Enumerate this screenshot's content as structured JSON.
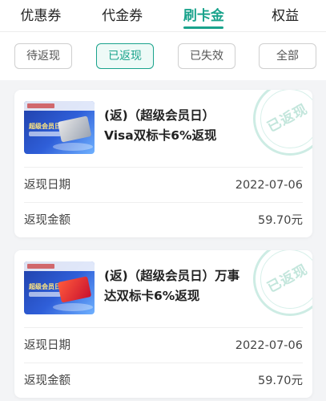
{
  "tabs": [
    {
      "label": "优惠券"
    },
    {
      "label": "代金券"
    },
    {
      "label": "刷卡金"
    },
    {
      "label": "权益"
    }
  ],
  "filters": [
    {
      "label": "待返现"
    },
    {
      "label": "已返现"
    },
    {
      "label": "已失效"
    },
    {
      "label": "全部"
    }
  ],
  "colors": {
    "accent": "#1aa38c",
    "stamp": "#c3e6dc"
  },
  "cards": [
    {
      "title_line1": "(返)（超级会员日）",
      "title_line2": "Visa双标卡6%返现",
      "thumb_text": "超级会员日",
      "stamp_text": "已返现",
      "date_label": "返现日期",
      "date_value": "2022-07-06",
      "amount_label": "返现金额",
      "amount_value": "59.70元"
    },
    {
      "title_line1": "(返)（超级会员日）万事",
      "title_line2": "达双标卡6%返现",
      "thumb_text": "超级会员日",
      "stamp_text": "已返现",
      "date_label": "返现日期",
      "date_value": "2022-07-06",
      "amount_label": "返现金额",
      "amount_value": "59.70元"
    }
  ]
}
